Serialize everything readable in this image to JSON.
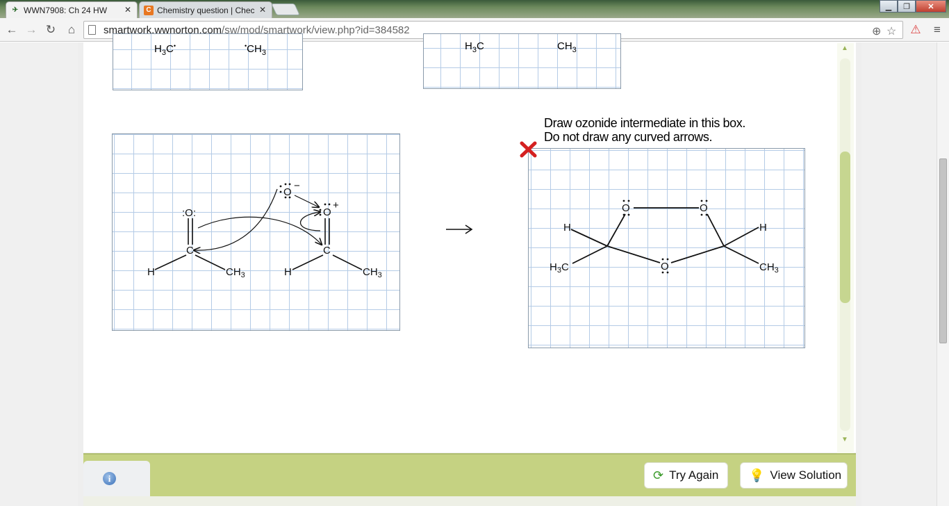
{
  "browser": {
    "tabs": [
      {
        "title": "WWN7908: Ch 24 HW",
        "active": true,
        "icon": "wwnorton-icon"
      },
      {
        "title": "Chemistry question | Chec",
        "active": false,
        "icon": "chegg-icon",
        "icon_text": "C"
      }
    ],
    "url_domain": "smartwork.wwnorton.com",
    "url_path": "/sw/mod/smartwork/view.php?id=384582"
  },
  "question": {
    "prompt_line1": "Draw ozonide intermediate in this box.",
    "prompt_line2": "Do not draw any curved arrows.",
    "reaction_arrow": "→"
  },
  "top_boxes": {
    "left": {
      "h3c": "H3C",
      "ch3": "CH3"
    },
    "right": {
      "h3c": "H3C",
      "ch3": "CH3"
    }
  },
  "mechanism_box": {
    "o_left": ":O:",
    "c_left": "C",
    "h_left": "H",
    "ch3_left": "CH3",
    "o_top": "O",
    "o_top_charge": "−",
    "o_right": "O",
    "o_right_charge": "+",
    "c_right": "C",
    "h_right": "H",
    "ch3_right": "CH3"
  },
  "answer_box": {
    "o_tl": "O",
    "o_tr": "O",
    "o_bottom": "O",
    "h_left": "H",
    "h_right": "H",
    "h3c": "H3C",
    "ch3": "CH3",
    "status": "incorrect"
  },
  "footer": {
    "try_again": "Try Again",
    "view_solution": "View Solution",
    "info": "i"
  },
  "colors": {
    "footer_bg": "#c5d282",
    "grid_line": "#b4cbe6",
    "error_mark": "#d42020"
  }
}
